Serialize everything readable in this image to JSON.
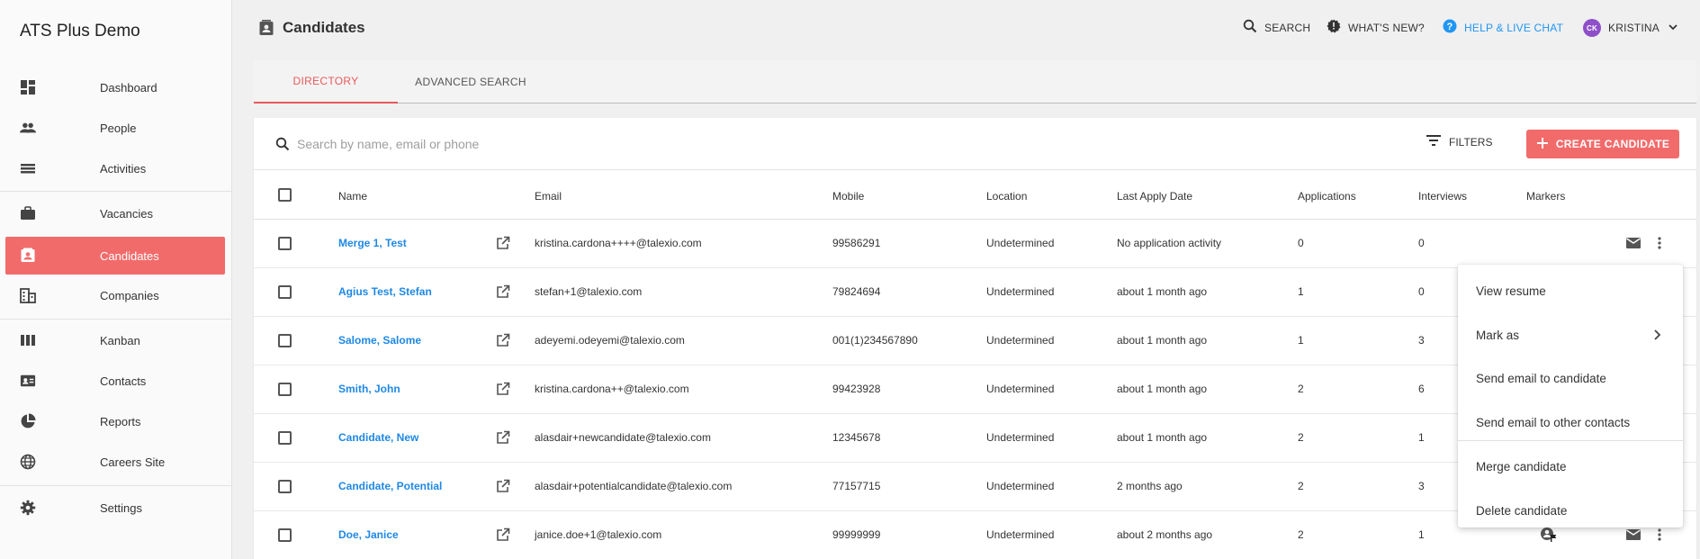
{
  "app": {
    "title": "ATS Plus Demo"
  },
  "sidebar": {
    "items": [
      {
        "label": "Dashboard",
        "icon": "dashboard-icon"
      },
      {
        "label": "People",
        "icon": "people-icon"
      },
      {
        "label": "Activities",
        "icon": "activities-icon"
      },
      {
        "label": "Vacancies",
        "icon": "briefcase-icon"
      },
      {
        "label": "Candidates",
        "icon": "candidate-card-icon",
        "active": true
      },
      {
        "label": "Companies",
        "icon": "building-icon"
      },
      {
        "label": "Kanban",
        "icon": "kanban-icon"
      },
      {
        "label": "Contacts",
        "icon": "contacts-icon"
      },
      {
        "label": "Reports",
        "icon": "pie-chart-icon"
      },
      {
        "label": "Careers Site",
        "icon": "globe-icon"
      },
      {
        "label": "Settings",
        "icon": "gear-icon"
      }
    ]
  },
  "header": {
    "title": "Candidates",
    "search_label": "SEARCH",
    "whats_new_label": "WHAT'S NEW?",
    "help_label": "HELP & LIVE CHAT",
    "user_initials": "CK",
    "user_name": "KRISTINA"
  },
  "tabs": [
    {
      "label": "DIRECTORY",
      "active": true
    },
    {
      "label": "ADVANCED SEARCH",
      "active": false
    }
  ],
  "toolbar": {
    "search_placeholder": "Search by name, email or phone",
    "search_value": "",
    "filters_label": "FILTERS",
    "create_label": "CREATE CANDIDATE"
  },
  "table": {
    "columns": [
      "Name",
      "Email",
      "Mobile",
      "Location",
      "Last Apply Date",
      "Applications",
      "Interviews",
      "Markers"
    ],
    "rows": [
      {
        "name": "Merge 1, Test",
        "email": "kristina.cardona++++@talexio.com",
        "mobile": "99586291",
        "location": "Undetermined",
        "last_apply": "No application activity",
        "applications": "0",
        "interviews": "0"
      },
      {
        "name": "Agius Test, Stefan",
        "email": "stefan+1@talexio.com",
        "mobile": "79824694",
        "location": "Undetermined",
        "last_apply": "about 1 month ago",
        "applications": "1",
        "interviews": "0"
      },
      {
        "name": "Salome, Salome",
        "email": "adeyemi.odeyemi@talexio.com",
        "mobile": "001(1)234567890",
        "location": "Undetermined",
        "last_apply": "about 1 month ago",
        "applications": "1",
        "interviews": "3"
      },
      {
        "name": "Smith, John",
        "email": "kristina.cardona++@talexio.com",
        "mobile": "99423928",
        "location": "Undetermined",
        "last_apply": "about 1 month ago",
        "applications": "2",
        "interviews": "6"
      },
      {
        "name": "Candidate, New",
        "email": "alasdair+newcandidate@talexio.com",
        "mobile": "12345678",
        "location": "Undetermined",
        "last_apply": "about 1 month ago",
        "applications": "2",
        "interviews": "1"
      },
      {
        "name": "Candidate, Potential",
        "email": "alasdair+potentialcandidate@talexio.com",
        "mobile": "77157715",
        "location": "Undetermined",
        "last_apply": "2 months ago",
        "applications": "2",
        "interviews": "3"
      },
      {
        "name": "Doe, Janice",
        "email": "janice.doe+1@talexio.com",
        "mobile": "99999999",
        "location": "Undetermined",
        "last_apply": "about 2 months ago",
        "applications": "2",
        "interviews": "1"
      }
    ]
  },
  "context_menu": {
    "items": [
      "View resume",
      "Mark as",
      "Send email to candidate",
      "Send email to other contacts",
      "Merge candidate",
      "Delete candidate"
    ]
  },
  "colors": {
    "accent": "#f26b6b",
    "link": "#1e88e5",
    "help": "#2196f3",
    "avatar": "#8e4fc9"
  }
}
